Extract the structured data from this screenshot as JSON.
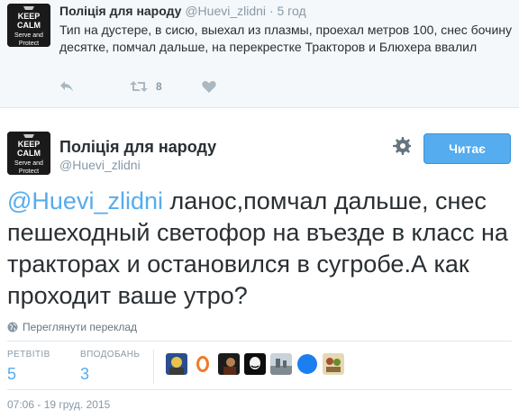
{
  "parent_tweet": {
    "fullname": "Поліція для народу",
    "username": "@Huevi_zlidni",
    "separator": "·",
    "time": "5 год",
    "text": "Тип на дустере, в сисю, выехал из плазмы, проехал метров 100, снес бочину десятке, помчал дальше, на перекрестке Тракторов и Блюхера ввалил",
    "avatar": {
      "line1": "KEEP",
      "line2": "CALM",
      "line3": "Serve and",
      "line4": "Protect"
    },
    "actions": {
      "reply_icon": "reply-icon",
      "retweet_icon": "retweet-icon",
      "retweet_count": "8",
      "like_icon": "heart-icon"
    }
  },
  "main_tweet": {
    "fullname": "Поліція для народу",
    "username": "@Huevi_zlidni",
    "avatar": {
      "line1": "KEEP",
      "line2": "CALM",
      "line3": "Serve and",
      "line4": "Protect"
    },
    "follow_button": "Читає",
    "settings_icon": "gear-icon",
    "mention": "@Huevi_zlidni",
    "text": " ланос,помчал дальше, снес пешеходный светофор на въезде в класс на тракторах и остановился в сугробе.А как проходит ваше утро?",
    "translate_label": "Переглянути переклад",
    "stats": {
      "retweets_label": "РЕТВІТІВ",
      "retweets_value": "5",
      "likes_label": "ВПОДОБАНЬ",
      "likes_value": "3"
    },
    "timestamp": "07:06 - 19 груд. 2015"
  },
  "colors": {
    "accent": "#55acee",
    "muted": "#8899a6",
    "text": "#292f33",
    "parent_bg": "#f5f8fa"
  }
}
